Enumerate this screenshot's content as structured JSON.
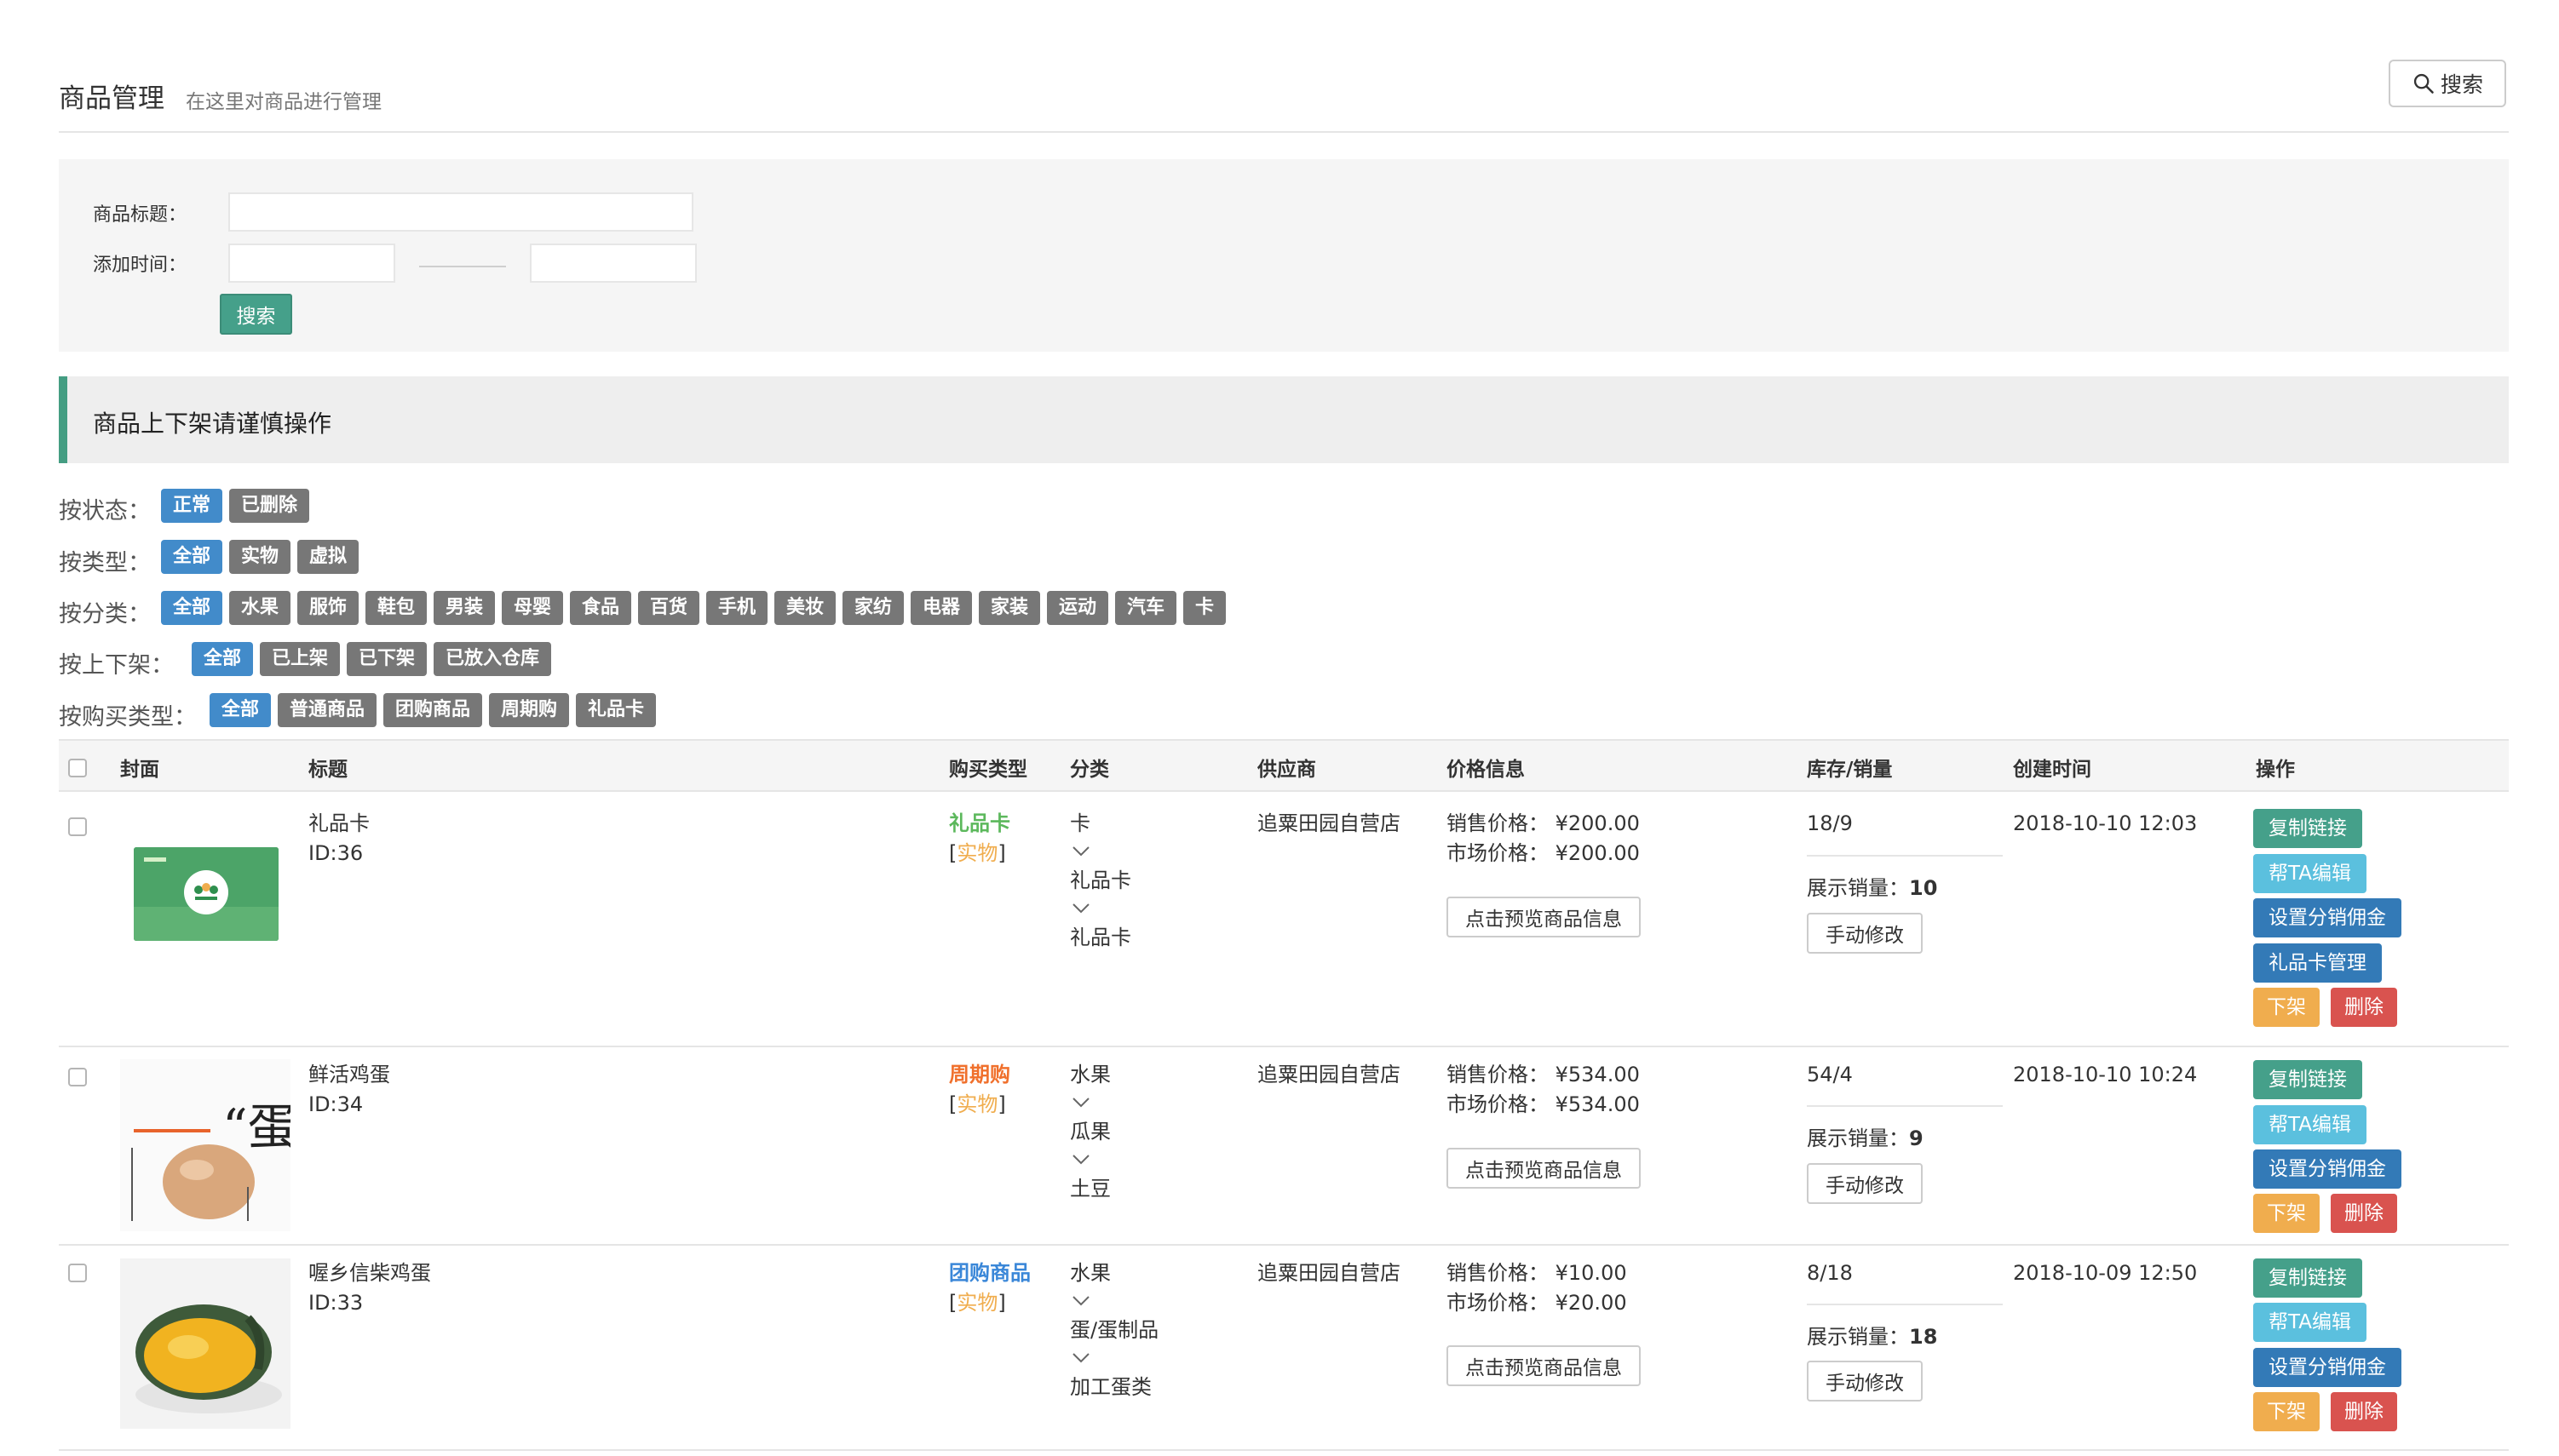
{
  "header": {
    "title": "商品管理",
    "subtitle": "在这里对商品进行管理",
    "search_button": "搜索"
  },
  "filter_form": {
    "title_label": "商品标题：",
    "title_value": "",
    "time_label": "添加时间：",
    "start_value": "",
    "end_value": "",
    "search_button": "搜索"
  },
  "notice": "商品上下架请谨慎操作",
  "filters": {
    "status": {
      "label": "按状态：",
      "options": [
        "正常",
        "已删除"
      ],
      "active": "正常"
    },
    "type": {
      "label": "按类型：",
      "options": [
        "全部",
        "实物",
        "虚拟"
      ],
      "active": "全部"
    },
    "category": {
      "label": "按分类：",
      "options": [
        "全部",
        "水果",
        "服饰",
        "鞋包",
        "男装",
        "母婴",
        "食品",
        "百货",
        "手机",
        "美妆",
        "家纺",
        "电器",
        "家装",
        "运动",
        "汽车",
        "卡"
      ],
      "active": "全部"
    },
    "shelf": {
      "label": "按上下架：",
      "options": [
        "全部",
        "已上架",
        "已下架",
        "已放入仓库"
      ],
      "active": "全部"
    },
    "purchase": {
      "label": "按购买类型：",
      "options": [
        "全部",
        "普通商品",
        "团购商品",
        "周期购",
        "礼品卡"
      ],
      "active": "全部"
    }
  },
  "table": {
    "columns": [
      "封面",
      "标题",
      "购买类型",
      "分类",
      "供应商",
      "价格信息",
      "库存/销量",
      "创建时间",
      "操作"
    ],
    "rows": [
      {
        "title": "礼品卡",
        "id": "ID:36",
        "buy_type": "礼品卡",
        "buy_type_color": "#5cb85c",
        "kind": "实物",
        "categories": [
          "卡",
          "礼品卡",
          "礼品卡"
        ],
        "supplier": "追粟田园自营店",
        "sale_price": "销售价格：  ¥200.00",
        "market_price": "市场价格：  ¥200.00",
        "preview": "点击预览商品信息",
        "stock": "18/9",
        "display_sales_label": "展示销量：",
        "display_sales": "10",
        "manual": "手动修改",
        "created": "2018-10-10 12:03",
        "actions": [
          "复制链接",
          "帮TA编辑",
          "设置分销佣金",
          "礼品卡管理",
          "下架",
          "删除"
        ]
      },
      {
        "title": "鲜活鸡蛋",
        "id": "ID:34",
        "buy_type": "周期购",
        "buy_type_color": "#f0702c",
        "kind": "实物",
        "categories": [
          "水果",
          "瓜果",
          "土豆"
        ],
        "supplier": "追粟田园自营店",
        "sale_price": "销售价格：  ¥534.00",
        "market_price": "市场价格：  ¥534.00",
        "preview": "点击预览商品信息",
        "stock": "54/4",
        "display_sales_label": "展示销量：",
        "display_sales": "9",
        "manual": "手动修改",
        "created": "2018-10-10 10:24",
        "actions": [
          "复制链接",
          "帮TA编辑",
          "设置分销佣金",
          "下架",
          "删除"
        ],
        "thumb_text": "“蛋”"
      },
      {
        "title": "喔乡信柴鸡蛋",
        "id": "ID:33",
        "buy_type": "团购商品",
        "buy_type_color": "#3a87d8",
        "kind": "实物",
        "categories": [
          "水果",
          "蛋/蛋制品",
          "加工蛋类"
        ],
        "supplier": "追粟田园自营店",
        "sale_price": "销售价格：  ¥10.00",
        "market_price": "市场价格：  ¥20.00",
        "preview": "点击预览商品信息",
        "stock": "8/18",
        "display_sales_label": "展示销量：",
        "display_sales": "18",
        "manual": "手动修改",
        "created": "2018-10-09 12:50",
        "actions": [
          "复制链接",
          "帮TA编辑",
          "设置分销佣金",
          "下架",
          "删除"
        ]
      }
    ]
  },
  "colors": {
    "accent_green": "#45a08a",
    "tag_active": "#428bca",
    "tag_default": "#777777"
  },
  "icons": {
    "search": "magnifier-icon",
    "dropdown": "chevron-down-icon"
  }
}
